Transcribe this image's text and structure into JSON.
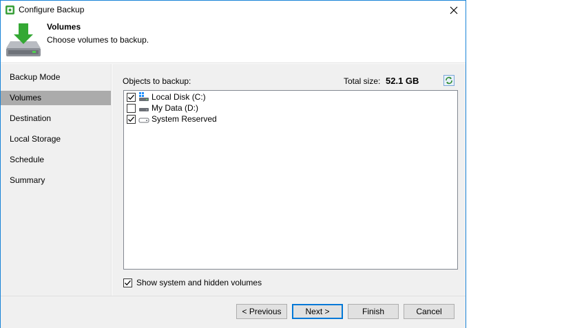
{
  "window": {
    "title": "Configure Backup"
  },
  "header": {
    "title": "Volumes",
    "subtitle": "Choose volumes to backup."
  },
  "sidebar": {
    "items": [
      {
        "label": "Backup Mode",
        "active": false
      },
      {
        "label": "Volumes",
        "active": true
      },
      {
        "label": "Destination",
        "active": false
      },
      {
        "label": "Local Storage",
        "active": false
      },
      {
        "label": "Schedule",
        "active": false
      },
      {
        "label": "Summary",
        "active": false
      }
    ]
  },
  "objects": {
    "label": "Objects to backup:",
    "total_size_label": "Total size:",
    "total_size_value": "52.1 GB",
    "volumes": [
      {
        "label": "Local Disk (C:)",
        "checked": true,
        "icon": "windows-drive-icon"
      },
      {
        "label": "My Data (D:)",
        "checked": false,
        "icon": "drive-icon"
      },
      {
        "label": "System Reserved",
        "checked": true,
        "icon": "drive-icon"
      }
    ]
  },
  "options": {
    "show_hidden_label": "Show system and hidden volumes",
    "show_hidden_checked": true
  },
  "buttons": {
    "previous": "< Previous",
    "next": "Next >",
    "finish": "Finish",
    "cancel": "Cancel"
  },
  "colors": {
    "accent": "#0078d7",
    "active_nav": "#ababab",
    "panel": "#f0f0f0",
    "check_green": "#3aa03a"
  }
}
